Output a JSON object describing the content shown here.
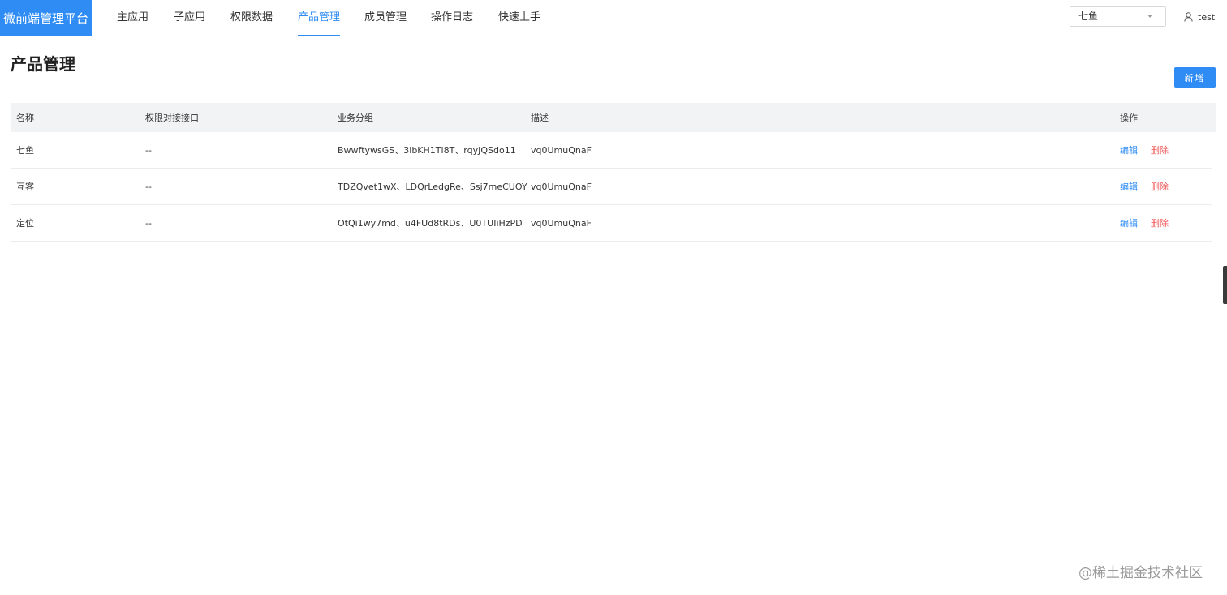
{
  "logo": "微前端管理平台",
  "nav": [
    {
      "label": "主应用",
      "active": false
    },
    {
      "label": "子应用",
      "active": false
    },
    {
      "label": "权限数据",
      "active": false
    },
    {
      "label": "产品管理",
      "active": true
    },
    {
      "label": "成员管理",
      "active": false
    },
    {
      "label": "操作日志",
      "active": false
    },
    {
      "label": "快速上手",
      "active": false
    }
  ],
  "selector": {
    "value": "七鱼"
  },
  "user": {
    "name": "test",
    "icon": "user-icon"
  },
  "page": {
    "title": "产品管理",
    "add_label": "新增"
  },
  "table": {
    "headers": {
      "name": "名称",
      "perm": "权限对接接口",
      "group": "业务分组",
      "desc": "描述",
      "ops": "操作"
    },
    "rows": [
      {
        "name": "七鱼",
        "perm": "--",
        "group": "BwwftywsGS、3lbKH1Tl8T、rqyJQSdo11",
        "desc": "vq0UmuQnaF",
        "edit": "编辑",
        "del": "删除"
      },
      {
        "name": "互客",
        "perm": "--",
        "group": "TDZQvet1wX、LDQrLedgRe、Ssj7meCUOY",
        "desc": "vq0UmuQnaF",
        "edit": "编辑",
        "del": "删除"
      },
      {
        "name": "定位",
        "perm": "--",
        "group": "OtQi1wy7md、u4FUd8tRDs、U0TUIiHzPD",
        "desc": "vq0UmuQnaF",
        "edit": "编辑",
        "del": "删除"
      }
    ]
  },
  "watermark": "@稀土掘金技术社区",
  "colors": {
    "accent": "#2f8cf5",
    "danger": "#f05a5a",
    "header_bg": "#f2f3f5"
  }
}
